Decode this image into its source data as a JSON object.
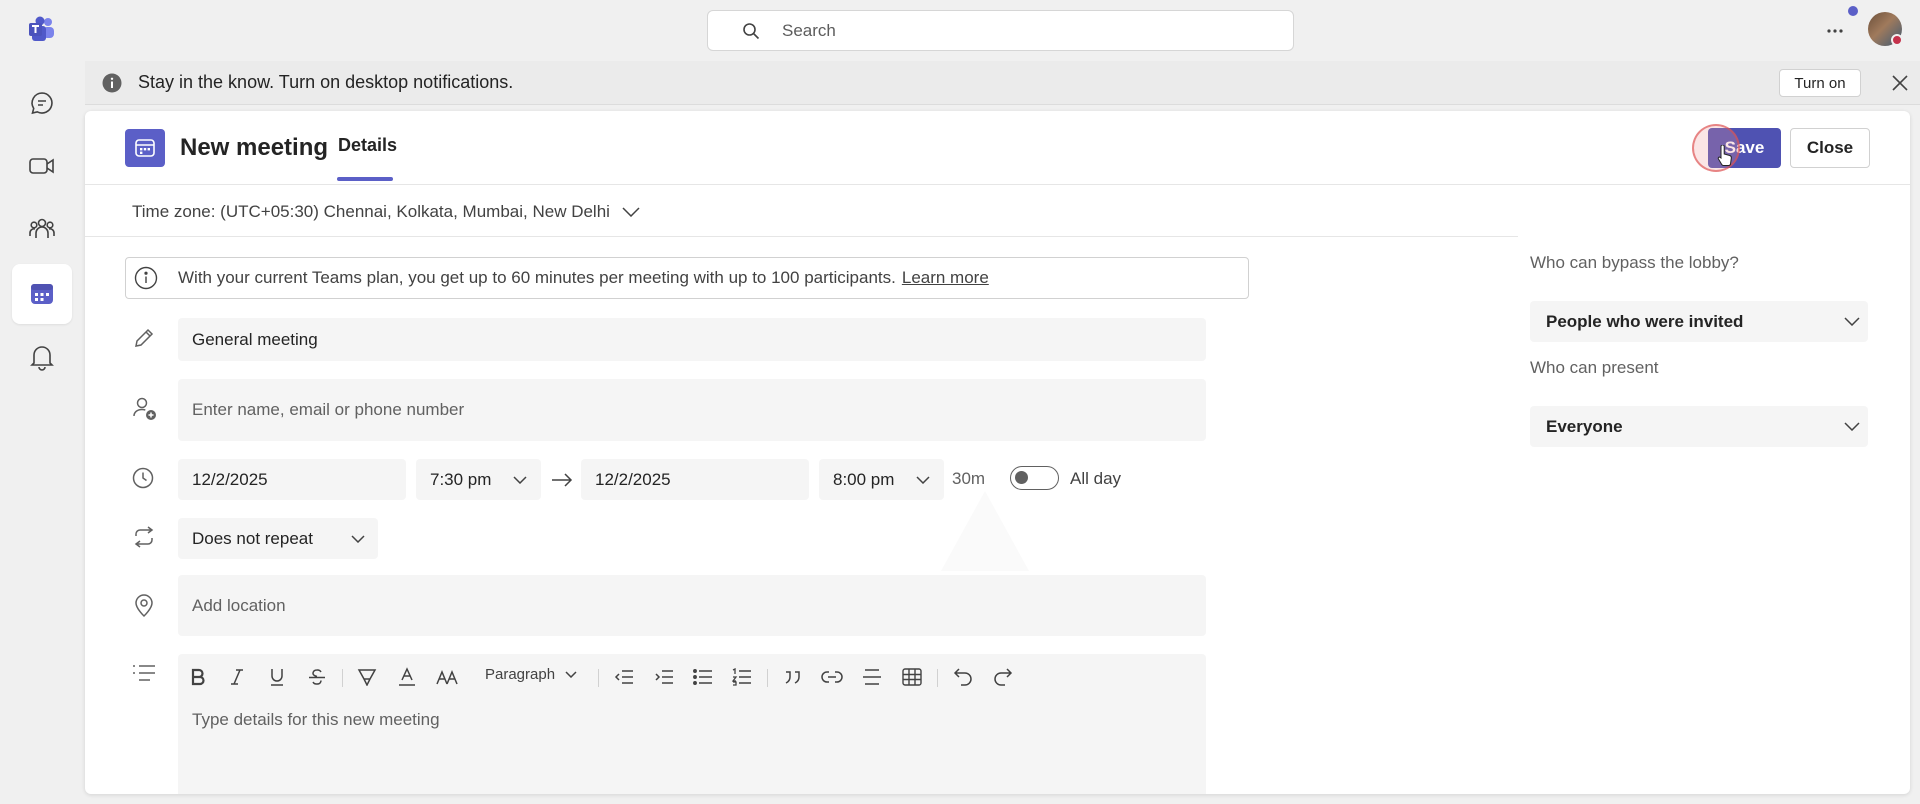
{
  "search": {
    "placeholder": "Search"
  },
  "banner": {
    "message": "Stay in the know. Turn on desktop notifications.",
    "turn_on_label": "Turn on"
  },
  "header": {
    "title": "New meeting",
    "tab_details": "Details",
    "save_label": "Save",
    "close_label": "Close"
  },
  "timezone": {
    "label": "Time zone: (UTC+05:30) Chennai, Kolkata, Mumbai, New Delhi"
  },
  "plan_notice": {
    "text": "With your current Teams plan, you get up to 60 minutes per meeting with up to 100 participants.",
    "link": "Learn more"
  },
  "form": {
    "title_value": "General meeting",
    "attendees_placeholder": "Enter name, email or phone number",
    "start_date": "12/2/2025",
    "start_time": "7:30 pm",
    "end_date": "12/2/2025",
    "end_time": "8:00 pm",
    "duration": "30m",
    "all_day_label": "All day",
    "all_day_on": false,
    "repeat": "Does not repeat",
    "location_placeholder": "Add location",
    "details_placeholder": "Type details for this new meeting",
    "paragraph_label": "Paragraph"
  },
  "options": {
    "bypass_label": "Who can bypass the lobby?",
    "bypass_value": "People who were invited",
    "present_label": "Who can present",
    "present_value": "Everyone"
  },
  "colors": {
    "accent": "#5b5fc7",
    "save_bg": "#4f52b2"
  }
}
